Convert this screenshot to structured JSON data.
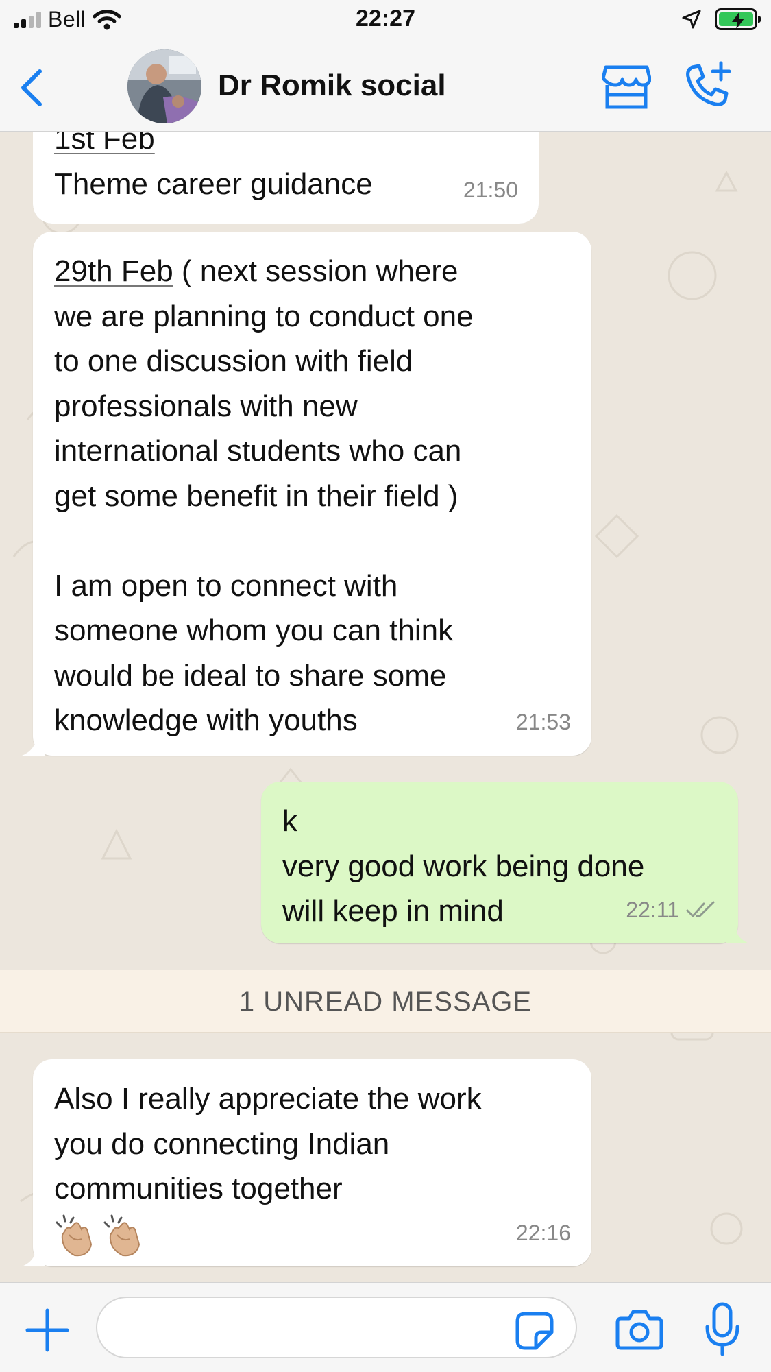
{
  "status_bar": {
    "carrier": "Bell",
    "time": "22:27",
    "icons": [
      "signal-icon",
      "wifi-icon",
      "location-arrow-icon",
      "battery-charging-icon"
    ]
  },
  "header": {
    "back_icon": "chevron-left-icon",
    "contact_name": "Dr Romik social",
    "avatar_icon": "contact-avatar",
    "store_icon": "storefront-icon",
    "call_icon": "phone-plus-icon",
    "accent_color": "#1a7ff0"
  },
  "messages": [
    {
      "direction": "incoming",
      "underlined_prefix": "1st Feb",
      "text": "\nTheme career guidance",
      "time": "21:50"
    },
    {
      "direction": "incoming",
      "underlined_prefix": "29th Feb",
      "text": " ( next session where\nwe are planning to conduct one\nto one discussion with field\nprofessionals with new\ninternational students who can\nget some benefit in their field )\n\nI am open to connect with\nsomeone whom you can think\nwould be ideal to share some\nknowledge with youths",
      "time": "21:53"
    },
    {
      "direction": "outgoing",
      "text": "k\nvery good work being done\nwill keep in mind",
      "time": "22:11",
      "status_icon": "double-check-icon"
    },
    {
      "direction": "incoming",
      "text": "Also I really appreciate the work\nyou do connecting Indian\ncommunities together",
      "emojis": [
        "clapping-hands-emoji",
        "clapping-hands-emoji"
      ],
      "time": "22:16"
    }
  ],
  "unread_banner": "1 UNREAD MESSAGE",
  "input_bar": {
    "plus_icon": "plus-icon",
    "sticker_icon": "sticker-icon",
    "camera_icon": "camera-icon",
    "mic_icon": "microphone-icon",
    "value": ""
  },
  "colors": {
    "incoming_bubble": "#ffffff",
    "outgoing_bubble": "#dcf8c6",
    "wallpaper": "#ece6dd",
    "unread_banner": "#f9f1e6",
    "battery": "#33c759"
  }
}
